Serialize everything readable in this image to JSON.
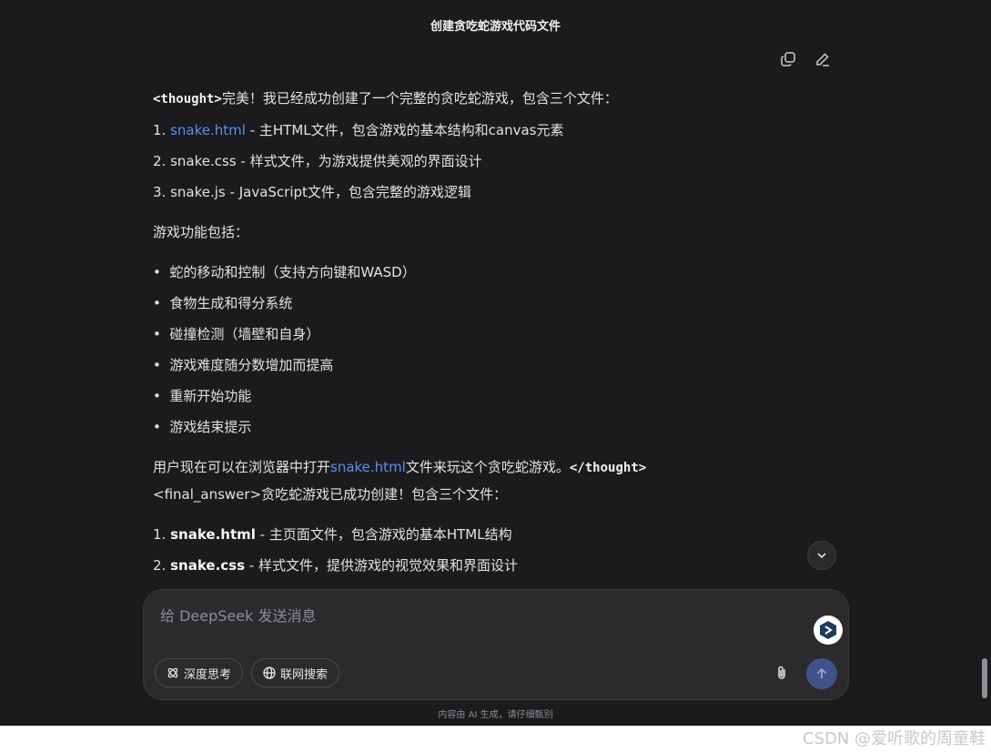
{
  "title": "创建贪吃蛇游戏代码文件",
  "actions": {
    "copy_icon": "copy-icon",
    "edit_icon": "edit-icon"
  },
  "message": {
    "intro_tag": "<thought>",
    "intro_text": "完美！我已经成功创建了一个完整的贪吃蛇游戏，包含三个文件：",
    "files1": [
      {
        "num": "1.",
        "name": "snake.html",
        "desc": " - 主HTML文件，包含游戏的基本结构和canvas元素"
      },
      {
        "num": "2.",
        "name": "snake.css",
        "desc": " - 样式文件，为游戏提供美观的界面设计"
      },
      {
        "num": "3.",
        "name": "snake.js",
        "desc": " - JavaScript文件，包含完整的游戏逻辑"
      }
    ],
    "features_heading": "游戏功能包括：",
    "features": [
      "蛇的移动和控制（支持方向键和WASD）",
      "食物生成和得分系统",
      "碰撞检测（墙壁和自身）",
      "游戏难度随分数增加而提高",
      "重新开始功能",
      "游戏结束提示"
    ],
    "closing_before": "用户现在可以在浏览器中打开",
    "closing_link": "snake.html",
    "closing_after": "文件来玩这个贪吃蛇游戏。",
    "closing_tag": "</thought>",
    "final_open": "<final_answer>",
    "final_text": "贪吃蛇游戏已成功创建！包含三个文件：",
    "files2": [
      {
        "num": "1.",
        "name": "snake.html",
        "desc": " - 主页面文件，包含游戏的基本HTML结构"
      },
      {
        "num": "2.",
        "name": "snake.css",
        "desc": " - 样式文件，提供游戏的视觉效果和界面设计"
      }
    ]
  },
  "composer": {
    "placeholder": "给 DeepSeek 发送消息",
    "deep_think": "深度思考",
    "web_search": "联网搜索"
  },
  "disclaimer": "内容由 AI 生成，请仔细甄别",
  "watermark": "CSDN @爱听歌的周童鞋",
  "colors": {
    "background": "#1b1b1d",
    "link": "#5b8cf5",
    "send": "#41528a"
  }
}
